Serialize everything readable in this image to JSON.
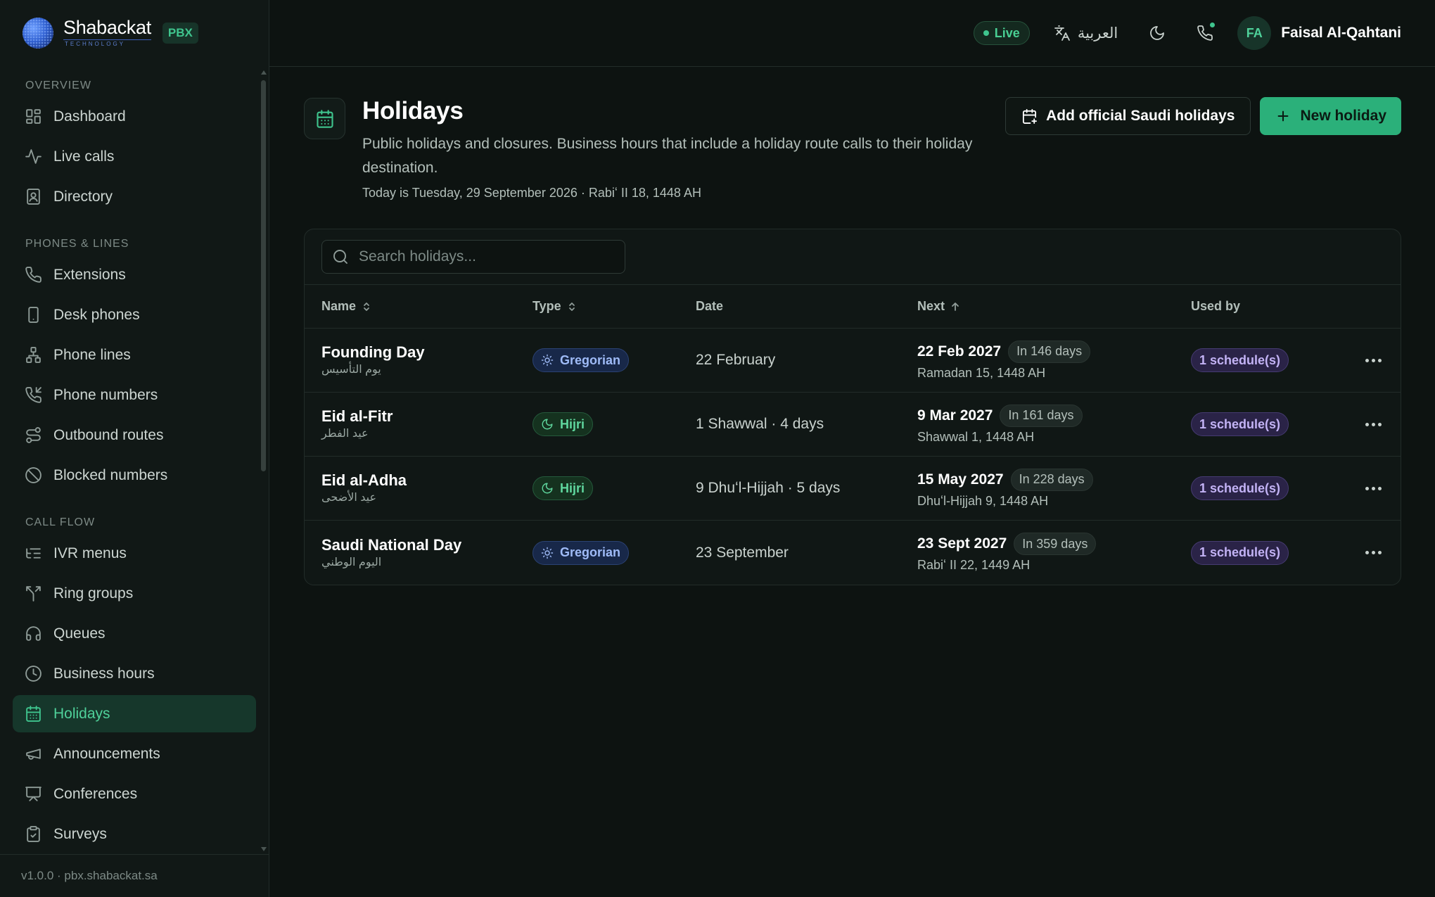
{
  "brand": {
    "name": "Shabackat",
    "sub": "TECHNOLOGY",
    "badge": "PBX"
  },
  "sidebar": {
    "sections": [
      {
        "title": "OVERVIEW",
        "items": [
          {
            "label": "Dashboard",
            "icon": "dashboard-icon"
          },
          {
            "label": "Live calls",
            "icon": "activity-icon"
          },
          {
            "label": "Directory",
            "icon": "contact-book-icon"
          }
        ]
      },
      {
        "title": "PHONES & LINES",
        "items": [
          {
            "label": "Extensions",
            "icon": "phone-icon"
          },
          {
            "label": "Desk phones",
            "icon": "smartphone-icon"
          },
          {
            "label": "Phone lines",
            "icon": "network-icon"
          },
          {
            "label": "Phone numbers",
            "icon": "phone-incoming-icon"
          },
          {
            "label": "Outbound routes",
            "icon": "route-icon"
          },
          {
            "label": "Blocked numbers",
            "icon": "ban-icon"
          }
        ]
      },
      {
        "title": "CALL FLOW",
        "items": [
          {
            "label": "IVR menus",
            "icon": "list-tree-icon"
          },
          {
            "label": "Ring groups",
            "icon": "split-icon"
          },
          {
            "label": "Queues",
            "icon": "headphones-icon"
          },
          {
            "label": "Business hours",
            "icon": "clock-icon"
          },
          {
            "label": "Holidays",
            "icon": "calendar-icon"
          },
          {
            "label": "Announcements",
            "icon": "megaphone-icon"
          },
          {
            "label": "Conferences",
            "icon": "presentation-icon"
          },
          {
            "label": "Surveys",
            "icon": "clipboard-check-icon"
          }
        ]
      }
    ],
    "active": "Holidays",
    "footer": "v1.0.0 · pbx.shabackat.sa"
  },
  "topbar": {
    "status": "Live",
    "language": "العربية",
    "user_initials": "FA",
    "user_name": "Faisal Al-Qahtani"
  },
  "page": {
    "title": "Holidays",
    "description": "Public holidays and closures. Business hours that include a holiday route calls to their holiday destination.",
    "today": "Today is Tuesday, 29 September 2026 · Rabiʻ II 18, 1448 AH",
    "add_official_label": "Add official Saudi holidays",
    "new_label": "New holiday"
  },
  "search": {
    "placeholder": "Search holidays..."
  },
  "table": {
    "columns": {
      "name": "Name",
      "type": "Type",
      "date": "Date",
      "next": "Next",
      "used": "Used by"
    },
    "sort": {
      "column": "Next",
      "direction": "ascending"
    },
    "rows": [
      {
        "name": "Founding Day",
        "name_ar": "يوم التأسيس",
        "type": "Gregorian",
        "type_icon": "sun-icon",
        "date": "22 February",
        "next": "22 Feb 2027",
        "in_days": "In 146 days",
        "next_hijri": "Ramadan 15, 1448 AH",
        "used_by": "1 schedule(s)"
      },
      {
        "name": "Eid al-Fitr",
        "name_ar": "عيد الفطر",
        "type": "Hijri",
        "type_icon": "moon-icon",
        "date": "1 Shawwal · 4 days",
        "next": "9 Mar 2027",
        "in_days": "In 161 days",
        "next_hijri": "Shawwal 1, 1448 AH",
        "used_by": "1 schedule(s)"
      },
      {
        "name": "Eid al-Adha",
        "name_ar": "عيد الأضحى",
        "type": "Hijri",
        "type_icon": "moon-icon",
        "date": "9 Dhuʻl-Hijjah · 5 days",
        "next": "15 May 2027",
        "in_days": "In 228 days",
        "next_hijri": "Dhuʻl-Hijjah 9, 1448 AH",
        "used_by": "1 schedule(s)"
      },
      {
        "name": "Saudi National Day",
        "name_ar": "اليوم الوطني",
        "type": "Gregorian",
        "type_icon": "sun-icon",
        "date": "23 September",
        "next": "23 Sept 2027",
        "in_days": "In 359 days",
        "next_hijri": "Rabiʻ II 22, 1449 AH",
        "used_by": "1 schedule(s)"
      }
    ]
  },
  "colors": {
    "accent": "#2bb07a",
    "background": "#0d1311",
    "sidebar": "#111816",
    "gregorian": "#9fbbf7",
    "hijri": "#5fd79e",
    "schedule": "#c3b3f5"
  }
}
